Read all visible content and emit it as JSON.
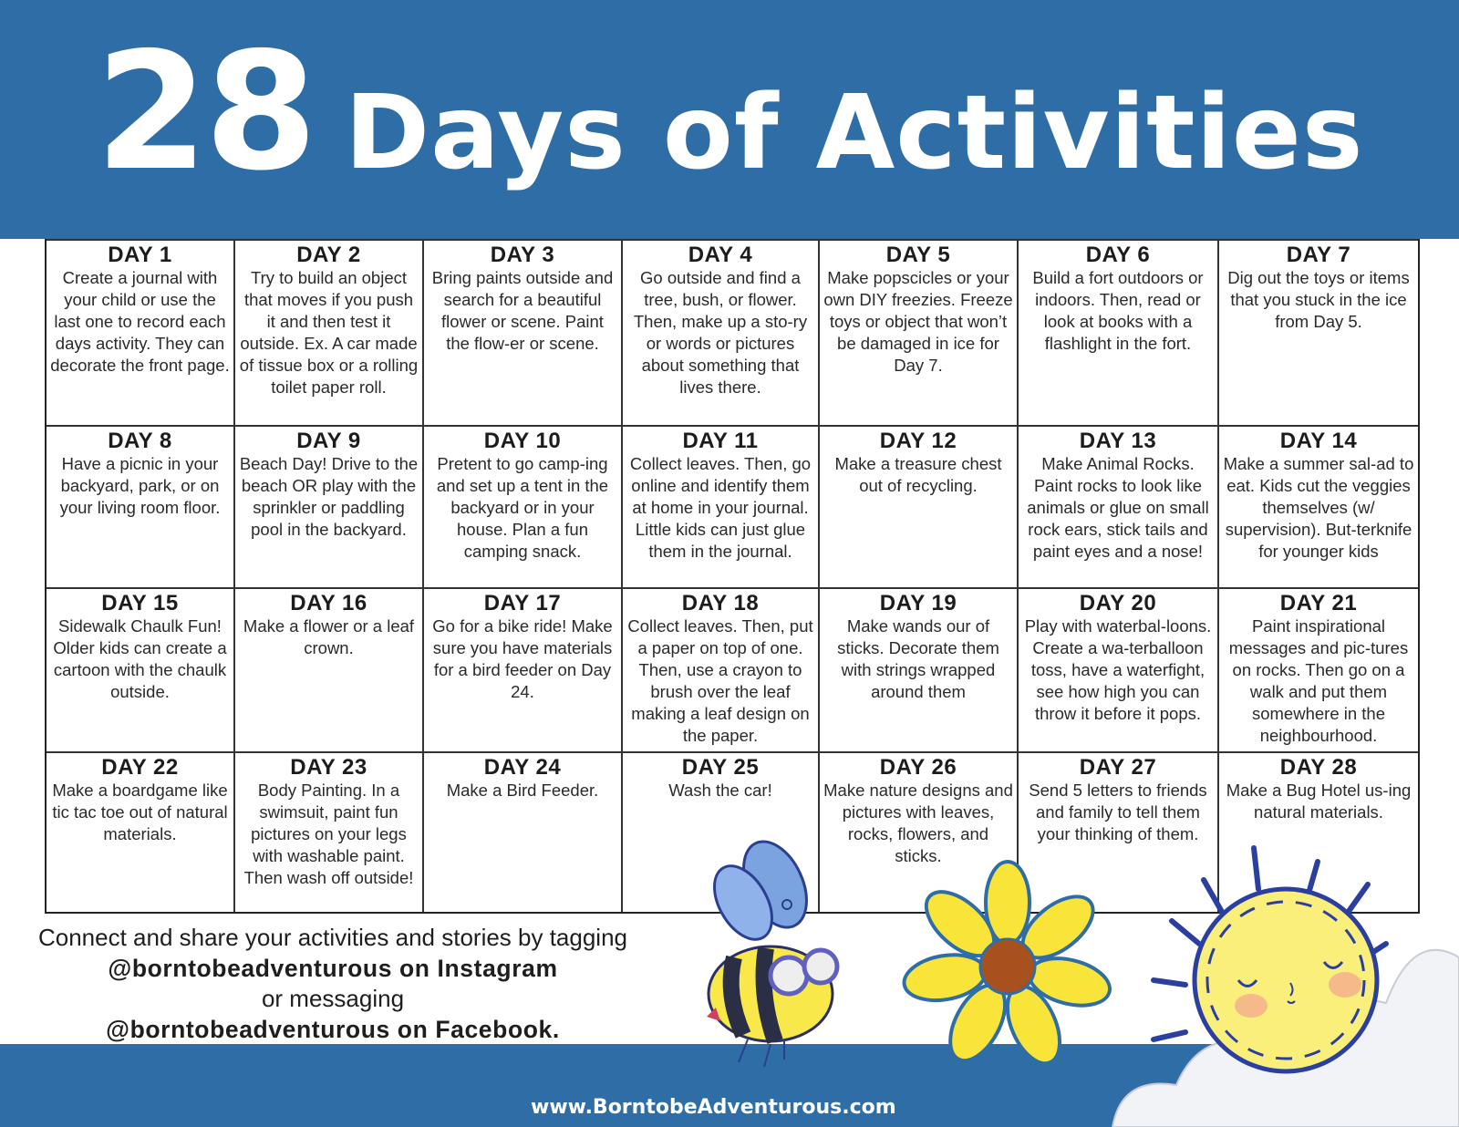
{
  "header": {
    "title_number": "28",
    "title_text": "Days of Activities",
    "background_color": "#2e6da6"
  },
  "days": [
    {
      "label": "DAY 1",
      "text": "Create a journal with your child or use the last one to record each days activity. They can decorate the front page."
    },
    {
      "label": "DAY 2",
      "text": "Try to build an object that moves if you push it and then test it outside. Ex. A car made of tissue box or a rolling toilet paper roll."
    },
    {
      "label": "DAY 3",
      "text": "Bring paints outside and search for a beautiful flower or scene. Paint the flow-er or scene."
    },
    {
      "label": "DAY 4",
      "text": "Go outside and find a tree, bush, or flower. Then, make up a sto-ry or words or pictures about something that lives there."
    },
    {
      "label": "DAY 5",
      "text": "Make popscicles or your own DIY freezies. Freeze toys or object that won’t be damaged in ice for Day 7."
    },
    {
      "label": "DAY 6",
      "text": "Build a fort outdoors or indoors. Then, read or look at books with a flashlight in the fort."
    },
    {
      "label": "DAY 7",
      "text": "Dig out the toys or items that you stuck in the ice from Day 5."
    },
    {
      "label": "DAY 8",
      "text": "Have a picnic in your backyard, park, or on your living room floor."
    },
    {
      "label": "DAY 9",
      "text": "Beach Day! Drive to the beach OR play with the sprinkler or paddling pool in the backyard."
    },
    {
      "label": "DAY 10",
      "text": "Pretent to go camp-ing and set up a tent in the backyard or in your house. Plan a fun camping snack."
    },
    {
      "label": "DAY 11",
      "text": "Collect leaves. Then, go online and identify them at home in your journal. Little kids can just glue them in the journal."
    },
    {
      "label": "DAY 12",
      "text": "Make a treasure chest out of recycling."
    },
    {
      "label": "DAY 13",
      "text": "Make Animal Rocks. Paint rocks to look like animals or glue on small rock ears, stick tails and paint eyes and a nose!"
    },
    {
      "label": "DAY 14",
      "text": "Make a summer sal-ad to eat. Kids cut the veggies themselves (w/ supervision). But-terknife for younger kids"
    },
    {
      "label": "DAY 15",
      "text": "Sidewalk Chaulk Fun! Older kids can create a cartoon with the chaulk outside."
    },
    {
      "label": "DAY 16",
      "text": "Make a flower or a leaf crown."
    },
    {
      "label": "DAY 17",
      "text": "Go for a bike ride! Make sure you have materials for a bird feeder on Day 24."
    },
    {
      "label": "DAY 18",
      "text": "Collect leaves. Then, put a paper on top of one. Then, use a crayon to brush over the leaf making a leaf design on the paper."
    },
    {
      "label": "DAY 19",
      "text": "Make wands our of sticks. Decorate them with strings wrapped around them"
    },
    {
      "label": "DAY 20",
      "text": "Play with waterbal-loons. Create a wa-terballoon toss, have a waterfight, see how high you can throw it before it pops."
    },
    {
      "label": "DAY 21",
      "text": "Paint inspirational messages and pic-tures on rocks. Then go on a walk and put them somewhere in the neighbourhood."
    },
    {
      "label": "DAY 22",
      "text": "Make a boardgame like tic tac toe out of natural materials."
    },
    {
      "label": "DAY 23",
      "text": "Body Painting. In a swimsuit, paint fun pictures on your legs with washable paint. Then wash off outside!"
    },
    {
      "label": "DAY 24",
      "text": "Make a Bird Feeder."
    },
    {
      "label": "DAY 25",
      "text": "Wash the car!"
    },
    {
      "label": "DAY 26",
      "text": "Make nature designs and pictures with leaves, rocks, flowers, and sticks."
    },
    {
      "label": "DAY 27",
      "text": "Send 5 letters to friends and family to tell them your thinking of them."
    },
    {
      "label": "DAY 28",
      "text": "Make a Bug Hotel us-ing natural materials."
    }
  ],
  "footer": {
    "line1": "Connect and share your activities and stories by tagging",
    "line2": "@borntobeadventurous on Instagram",
    "line3": "or messaging",
    "line4": "@borntobeadventurous on Facebook.",
    "website": "www.BorntobeAdventurous.com"
  },
  "illustrations": [
    "bee-icon",
    "flower-icon",
    "sun-icon",
    "cloud-icon"
  ]
}
